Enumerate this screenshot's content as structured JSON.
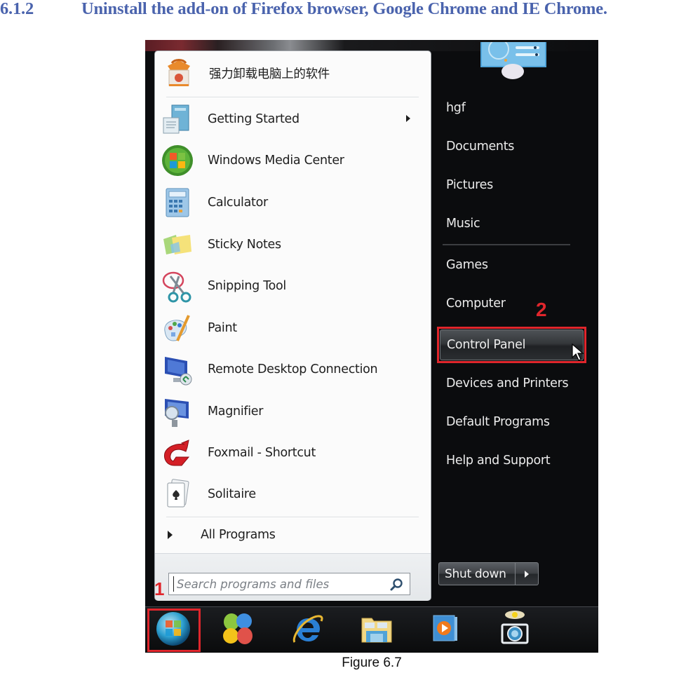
{
  "document": {
    "section_number": "6.1.2",
    "section_title": "Uninstall the add-on of Firefox browser, Google Chrome and IE Chrome.",
    "figure_caption": "Figure 6.7",
    "heading_color": "#4a63ad"
  },
  "start_menu": {
    "pinned": [
      {
        "label": "强力卸载电脑上的软件",
        "icon": "uninstaller-box-icon"
      }
    ],
    "programs": [
      {
        "label": "Getting Started",
        "icon": "getting-started-icon",
        "has_submenu": true
      },
      {
        "label": "Windows Media Center",
        "icon": "windows-media-center-icon",
        "has_submenu": false
      },
      {
        "label": "Calculator",
        "icon": "calculator-icon",
        "has_submenu": false
      },
      {
        "label": "Sticky Notes",
        "icon": "sticky-notes-icon",
        "has_submenu": false
      },
      {
        "label": "Snipping Tool",
        "icon": "snipping-tool-icon",
        "has_submenu": false
      },
      {
        "label": "Paint",
        "icon": "paint-icon",
        "has_submenu": false
      },
      {
        "label": "Remote Desktop Connection",
        "icon": "remote-desktop-icon",
        "has_submenu": false
      },
      {
        "label": "Magnifier",
        "icon": "magnifier-icon",
        "has_submenu": false
      },
      {
        "label": "Foxmail - Shortcut",
        "icon": "foxmail-icon",
        "has_submenu": false
      },
      {
        "label": "Solitaire",
        "icon": "solitaire-icon",
        "has_submenu": false
      }
    ],
    "all_programs_label": "All Programs",
    "search": {
      "placeholder": "Search programs and files",
      "value": "",
      "icon": "search-icon"
    },
    "right_items": [
      {
        "label": "hgf"
      },
      {
        "label": "Documents"
      },
      {
        "label": "Pictures"
      },
      {
        "label": "Music"
      },
      {
        "label": "Games"
      },
      {
        "label": "Computer"
      },
      {
        "label": "Control Panel",
        "active": true
      },
      {
        "label": "Devices and Printers"
      },
      {
        "label": "Default Programs"
      },
      {
        "label": "Help and Support"
      }
    ],
    "shutdown_label": "Shut down",
    "shutdown_options_icon": "triangle-right-icon"
  },
  "annotations": {
    "step_1": "1",
    "step_2": "2",
    "color": "#e0262c"
  },
  "taskbar": {
    "items": [
      {
        "name": "start-orb",
        "icon": "windows-start-orb-icon"
      },
      {
        "name": "colorful-app",
        "icon": "four-petal-app-icon"
      },
      {
        "name": "internet-explorer",
        "icon": "internet-explorer-icon"
      },
      {
        "name": "windows-explorer",
        "icon": "folder-library-icon"
      },
      {
        "name": "media-player",
        "icon": "media-player-icon"
      },
      {
        "name": "camera-app",
        "icon": "camera-icon"
      }
    ]
  }
}
